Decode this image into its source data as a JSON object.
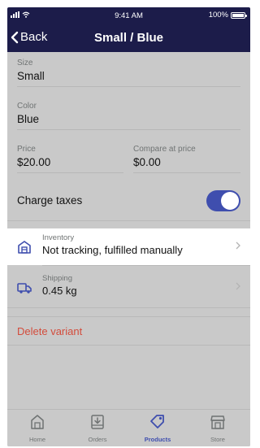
{
  "status": {
    "time": "9:41 AM",
    "battery": "100%"
  },
  "nav": {
    "back_label": "Back",
    "title": "Small / Blue"
  },
  "fields": {
    "size_label": "Size",
    "size_value": "Small",
    "color_label": "Color",
    "color_value": "Blue",
    "price_label": "Price",
    "price_value": "$20.00",
    "compare_label": "Compare at price",
    "compare_value": "$0.00"
  },
  "charge_taxes": {
    "label": "Charge taxes",
    "enabled": true
  },
  "inventory": {
    "label": "Inventory",
    "value": "Not tracking, fulfilled manually"
  },
  "shipping": {
    "label": "Shipping",
    "value": "0.45 kg"
  },
  "delete_label": "Delete variant",
  "tabs": [
    {
      "label": "Home",
      "icon": "home-icon",
      "active": false
    },
    {
      "label": "Orders",
      "icon": "orders-icon",
      "active": false
    },
    {
      "label": "Products",
      "icon": "tag-icon",
      "active": true
    },
    {
      "label": "Store",
      "icon": "store-icon",
      "active": false
    }
  ],
  "colors": {
    "nav_bg": "#1c1c4a",
    "accent": "#3f4eae",
    "danger": "#d34c3c",
    "overlay": "#c9c9c9"
  }
}
